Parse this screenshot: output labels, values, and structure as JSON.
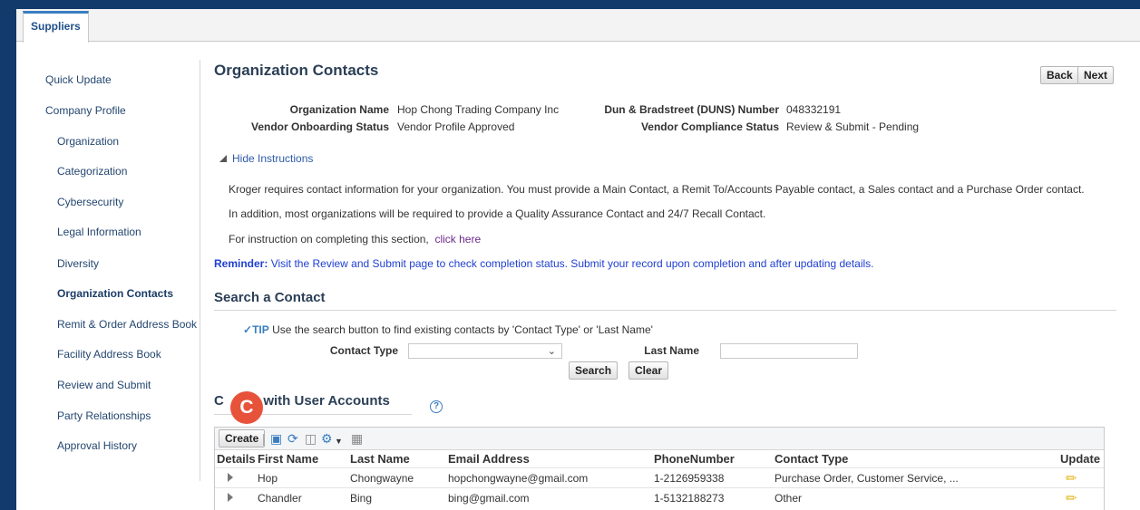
{
  "tabs": {
    "suppliers": "Suppliers"
  },
  "sidebar": {
    "items": [
      "Quick Update",
      "Company Profile",
      "Organization",
      "Categorization",
      "Cybersecurity",
      "Legal Information",
      "Diversity",
      "Organization Contacts",
      "Remit & Order Address Book",
      "Facility Address Book",
      "Review and Submit",
      "Party Relationships",
      "Approval History"
    ],
    "active": "Organization Contacts"
  },
  "page": {
    "title": "Organization Contacts",
    "back_label": "Back",
    "next_label": "Next"
  },
  "org_info": {
    "org_name_label": "Organization Name",
    "org_name_value": "Hop Chong Trading Company Inc",
    "onboarding_label": "Vendor Onboarding Status",
    "onboarding_value": "Vendor Profile Approved",
    "duns_label": "Dun & Bradstreet (DUNS) Number",
    "duns_value": "048332191",
    "compliance_label": "Vendor Compliance Status",
    "compliance_value": "Review & Submit - Pending"
  },
  "instructions": {
    "toggle_label": "Hide Instructions",
    "line1": "Kroger requires contact information for your organization. You must provide a Main Contact, a Remit To/Accounts Payable contact, a Sales contact and a Purchase Order contact.",
    "line2": "In addition, most organizations will be required to provide a Quality Assurance Contact and 24/7 Recall Contact.",
    "line3": "For instruction on completing this section,",
    "line3_link": "click here",
    "reminder_bold": "Reminder:",
    "reminder_text": "Visit the Review and Submit page to check completion status. Submit your record upon completion and after updating details."
  },
  "search": {
    "title": "Search a Contact",
    "tip_label": "TIP",
    "tip_text": "Use the search button to find existing contacts by 'Contact Type' or 'Last Name'",
    "contact_type_label": "Contact Type",
    "contact_type_value": "",
    "last_name_label": "Last Name",
    "last_name_value": "",
    "search_button": "Search",
    "clear_button": "Clear"
  },
  "contacts": {
    "title": "ts with User Accounts",
    "title_prefix": "C",
    "help_icon": "?",
    "create_button": "Create",
    "columns": [
      "Details",
      "First Name",
      "Last Name",
      "Email Address",
      "PhoneNumber",
      "Contact Type",
      "Update"
    ],
    "rows": [
      {
        "first": "Hop",
        "last": "Chongwayne",
        "email": "hopchongwayne@gmail.com",
        "phone": "1-2126959338",
        "type": "Purchase Order, Customer Service, ..."
      },
      {
        "first": "Chandler",
        "last": "Bing",
        "email": "bing@gmail.com",
        "phone": "1-5132188273",
        "type": "Other"
      }
    ]
  },
  "badge": {
    "letter": "C"
  },
  "colors": {
    "accent": "#3a7ec0",
    "title": "#2b3f56",
    "link": "#2e5aa8",
    "reminder": "#2040d0",
    "badge": "#e7533a",
    "frame": "#123a6b"
  }
}
